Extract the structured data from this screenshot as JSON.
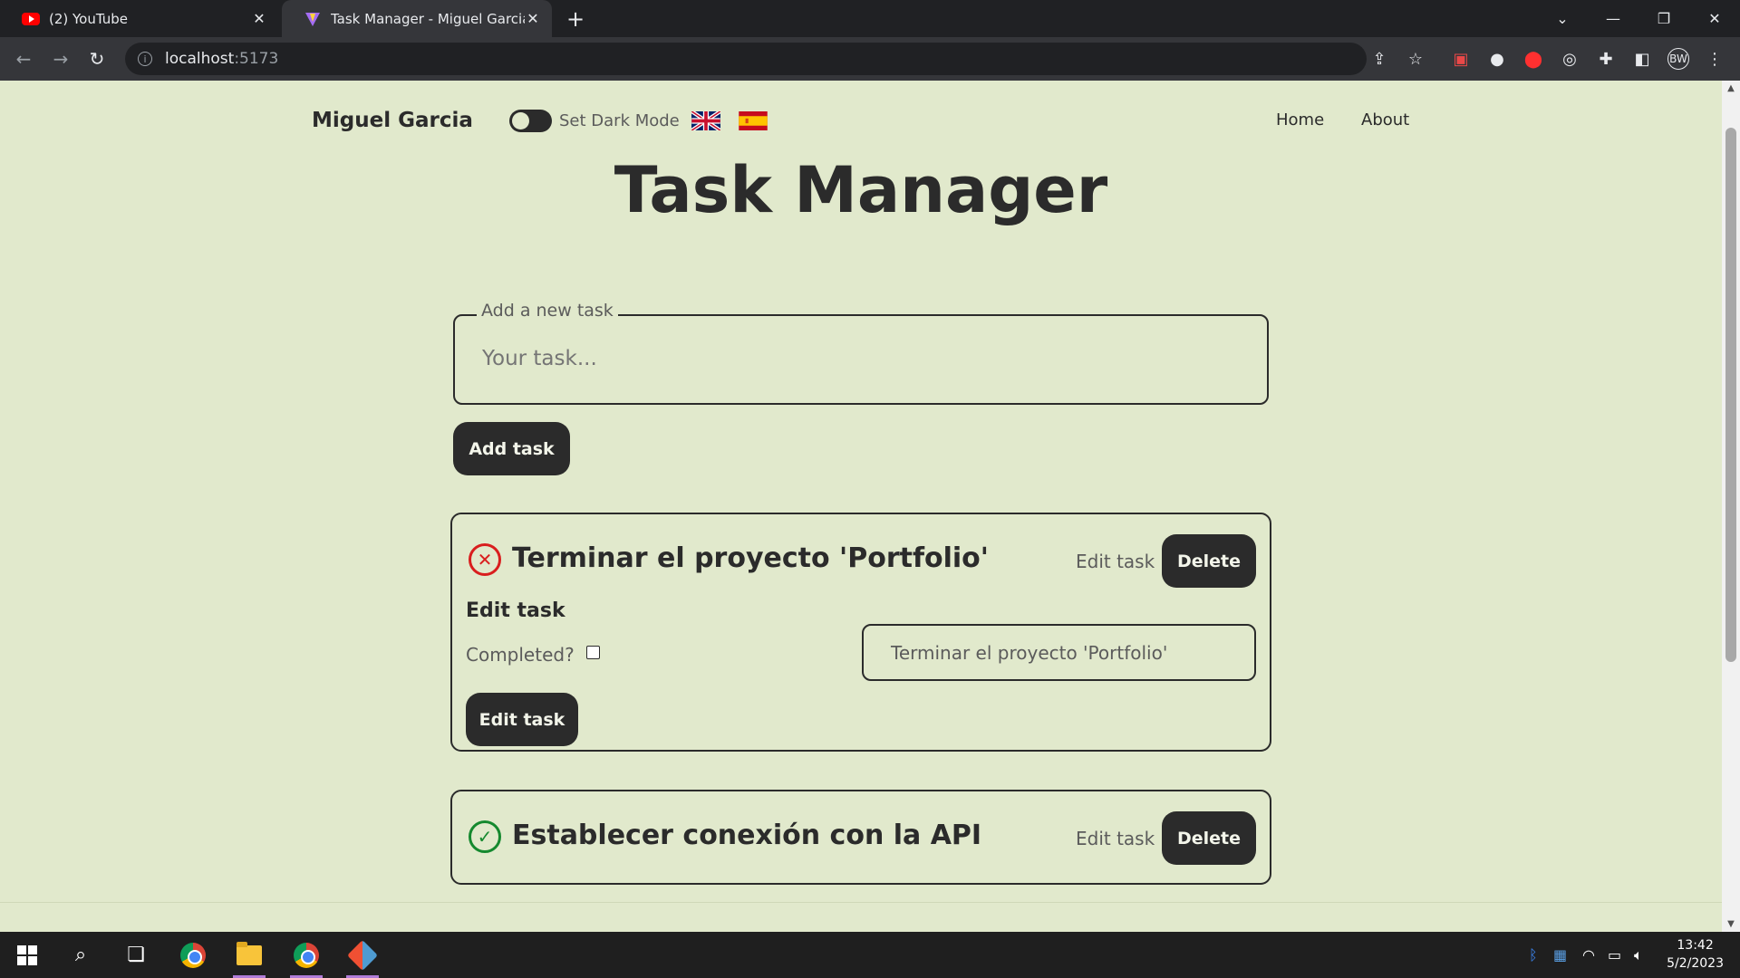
{
  "browser": {
    "tabs": [
      {
        "label": "(2) YouTube",
        "active": false
      },
      {
        "label": "Task Manager - Miguel Garcia",
        "active": true
      }
    ],
    "url_host": "localhost",
    "url_port": ":5173"
  },
  "page": {
    "brand": "Miguel Garcia",
    "darkmode_label": "Set Dark Mode",
    "nav": {
      "home": "Home",
      "about": "About"
    },
    "title": "Task Manager",
    "add_task": {
      "legend": "Add a new task",
      "placeholder": "Your task...",
      "button": "Add task"
    },
    "tasks": [
      {
        "title": "Terminar el proyecto 'Portfolio'",
        "completed": false,
        "edit_link": "Edit task",
        "delete_label": "Delete",
        "edit_form": {
          "heading": "Edit task",
          "completed_label": "Completed?",
          "input_value": "Terminar el proyecto 'Portfolio'",
          "button": "Edit task"
        }
      },
      {
        "title": "Establecer conexión con la API",
        "completed": true,
        "edit_link": "Edit task",
        "delete_label": "Delete"
      }
    ]
  },
  "taskbar": {
    "time": "13:42",
    "date": "5/2/2023"
  },
  "colors": {
    "page_bg": "#e1e9cc",
    "dark": "#2b2b2b",
    "incomplete": "#d91e1e",
    "complete": "#15892f"
  }
}
